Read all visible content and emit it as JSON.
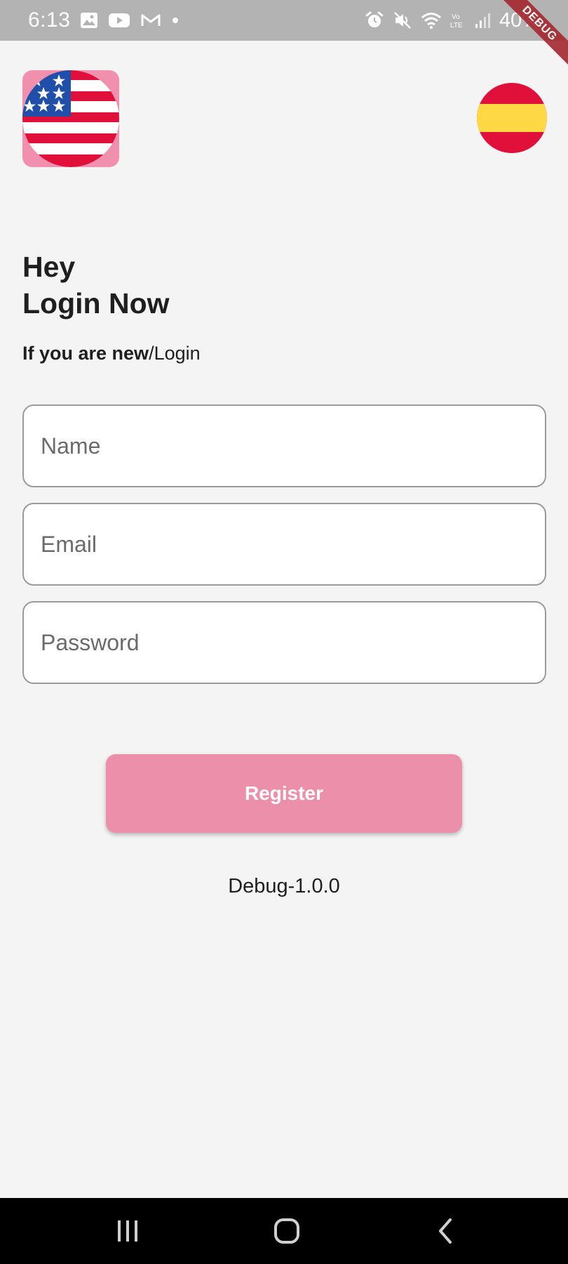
{
  "status_bar": {
    "time": "6:13",
    "battery": "40%",
    "left_icons": [
      "gallery-icon",
      "youtube-icon",
      "gmail-icon",
      "dot-icon"
    ],
    "right_icons": [
      "alarm-icon",
      "mute-icon",
      "wifi-icon",
      "volte-icon",
      "signal-icon"
    ]
  },
  "debug_ribbon": "DEBUG",
  "languages": {
    "left": "us-flag-icon",
    "right": "spain-flag-icon"
  },
  "heading": {
    "line1": "Hey",
    "line2": "Login Now"
  },
  "subtitle": {
    "strong": "If you are new",
    "rest": "/Login"
  },
  "form": {
    "name_placeholder": "Name",
    "email_placeholder": "Email",
    "password_placeholder": "Password",
    "name_value": "",
    "email_value": "",
    "password_value": ""
  },
  "register_label": "Register",
  "version": "Debug-1.0.0",
  "nav": {
    "recents": "recents-icon",
    "home": "home-icon",
    "back": "back-icon"
  },
  "colors": {
    "accent": "#ec8fab",
    "background": "#f4f4f4",
    "status_bar": "#b3b3b3",
    "nav_bar": "#000000"
  }
}
